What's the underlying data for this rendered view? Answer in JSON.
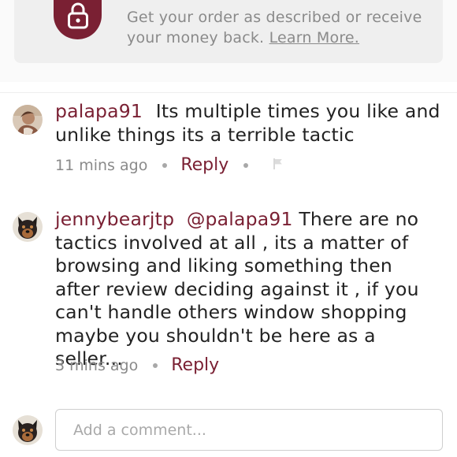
{
  "guarantee": {
    "line1": "Get your order as described or receive",
    "line2_prefix": "your money back.",
    "learn_more": "Learn More.",
    "lock_icon": "lock-icon",
    "accent_color": "#7a2033"
  },
  "comments": [
    {
      "username": "palapa91",
      "text": "Its multiple times you like and unlike things its a terrible tactic",
      "time": "11 mins ago",
      "reply_label": "Reply",
      "show_flag": true
    },
    {
      "username": "jennybearjtp",
      "mention": "@palapa91",
      "text": "There are no tactics involved at all , its a matter of browsing and liking something then after review deciding against it , if you can't handle others window shopping maybe you shouldn't be here as a seller...",
      "time": "3 mins ago",
      "reply_label": "Reply"
    }
  ],
  "add_comment": {
    "placeholder": "Add a comment..."
  }
}
